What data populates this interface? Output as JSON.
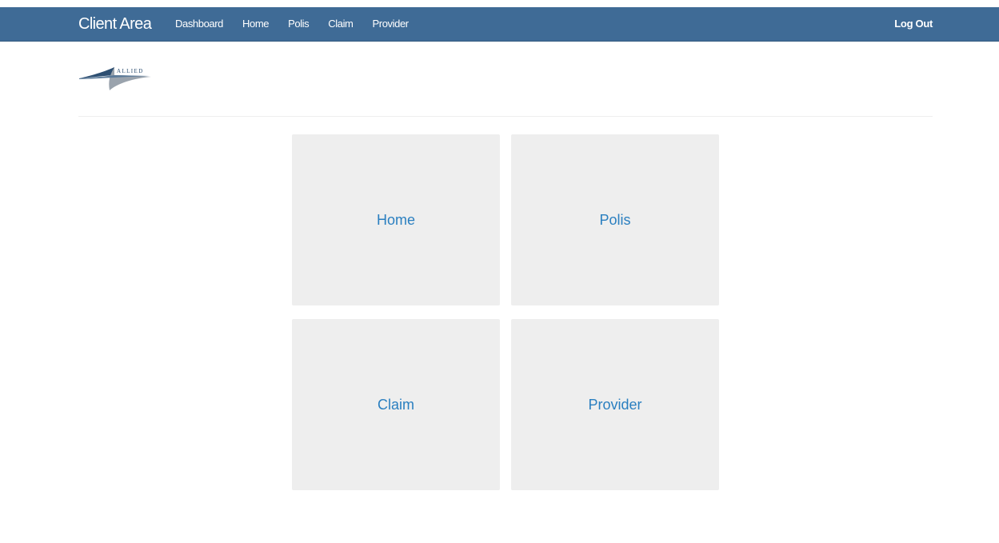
{
  "navbar": {
    "brand": "Client Area",
    "links": [
      "Dashboard",
      "Home",
      "Polis",
      "Claim",
      "Provider"
    ],
    "logout": "Log Out"
  },
  "logo": {
    "text": "ALLIED"
  },
  "tiles": [
    {
      "label": "Home"
    },
    {
      "label": "Polis"
    },
    {
      "label": "Claim"
    },
    {
      "label": "Provider"
    }
  ],
  "colors": {
    "navbar_bg": "#3f6b96",
    "tile_bg": "#eeeeee",
    "tile_text": "#2a7fc0"
  }
}
